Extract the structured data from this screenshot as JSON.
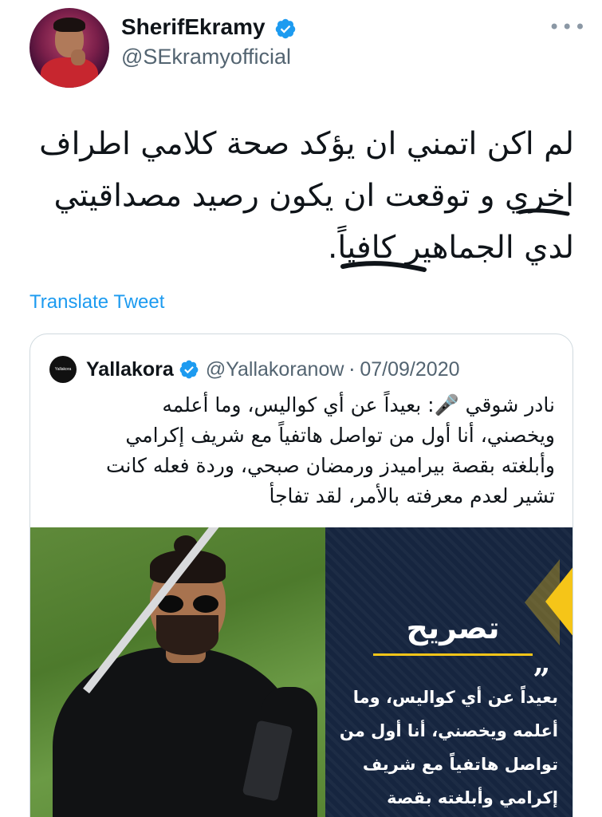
{
  "author": {
    "display_name": "SherifEkramy",
    "handle": "@SEkramyofficial",
    "verified": true,
    "avatar_icon": "profile-photo"
  },
  "tweet": {
    "lines": [
      "لم اكن اتمني ان يؤكد صحة كلامي اطراف",
      "اخري و توقعت ان يكون رصيد مصداقيتي",
      "لدي الجماهير كافياً."
    ]
  },
  "translate_label": "Translate Tweet",
  "quoted": {
    "name": "Yallakora",
    "logo_text": "Yallakora",
    "handle": "@Yallakoranow",
    "separator": "·",
    "date": "07/09/2020",
    "verified": true,
    "lines": [
      "نادر شوقي 🎤: بعيداً عن أي كواليس، وما أعلمه",
      "ويخصني، أنا أول من تواصل هاتفياً مع شريف إكرامي",
      "وأبلغته بقصة بيراميدز ورمضان صبحي، وردة فعله كانت",
      "تشير لعدم معرفته بالأمر، لقد تفاجأ"
    ],
    "media": {
      "panel_title": "تصريح",
      "panel_quote_mark": "”",
      "panel_lines": [
        "بعيداً عن أي كواليس، وما",
        "أعلمه ويخصني، أنا أول من",
        "تواصل هاتفياً مع شريف",
        "إكرامي وأبلغته بقصة"
      ]
    }
  },
  "colors": {
    "link": "#1d9bf0",
    "verified": "#1d9bf0",
    "panel_bg": "#16253f",
    "panel_accent": "#f5c518"
  }
}
